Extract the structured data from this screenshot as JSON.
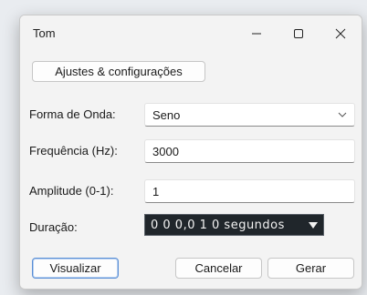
{
  "window": {
    "title": "Tom",
    "minimize_icon": "minimize-icon",
    "maximize_icon": "maximize-icon",
    "close_icon": "close-icon"
  },
  "toolbar": {
    "settings_label": "Ajustes & configurações"
  },
  "form": {
    "waveform": {
      "label": "Forma de Onda:",
      "value": "Seno"
    },
    "frequency": {
      "label": "Frequência (Hz):",
      "value": "3000"
    },
    "amplitude": {
      "label": "Amplitude (0-1):",
      "value": "1"
    },
    "duration": {
      "label": "Duração:",
      "value": "0 0 0,0 1 0 segundos"
    }
  },
  "buttons": {
    "preview": "Visualizar",
    "cancel": "Cancelar",
    "generate": "Gerar"
  },
  "colors": {
    "accent_border": "#5a8fd6",
    "duration_bg": "#20262b"
  }
}
